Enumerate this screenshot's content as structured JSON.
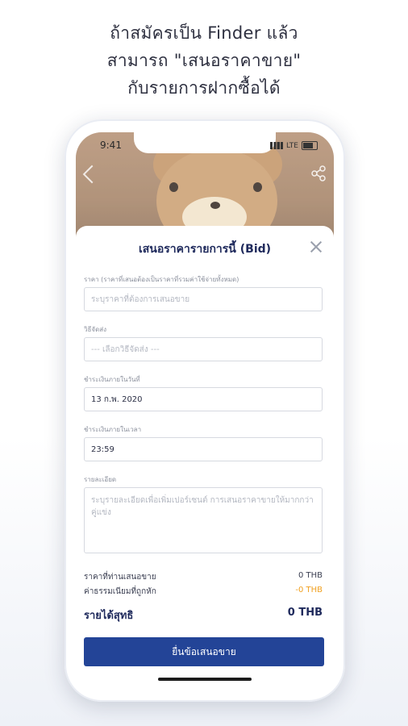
{
  "headline": {
    "line1": "ถ้าสมัครเป็น Finder แล้ว",
    "line2": "สามารถ \"เสนอราคาขาย\"",
    "line3": "กับรายการฝากซื้อได้"
  },
  "status_bar": {
    "time": "9:41",
    "network": "LTE"
  },
  "sheet": {
    "title": "เสนอราคารายการนี้ (Bid)",
    "price": {
      "label": "ราคา (ราคาที่เสนอต้องเป็นราคาที่รวมค่าใช้จ่ายทั้งหมด)",
      "placeholder": "ระบุราคาที่ต้องการเสนอขาย"
    },
    "shipping": {
      "label": "วิธีจัดส่ง",
      "placeholder": "--- เลือกวิธีจัดส่ง ---"
    },
    "date": {
      "label": "ชำระเงินภายในวันที่",
      "value": "13 ก.พ. 2020"
    },
    "time": {
      "label": "ชำระเงินภายในเวลา",
      "value": "23:59"
    },
    "details": {
      "label": "รายละเอียด",
      "placeholder": "ระบุรายละเอียดเพื่อเพิ่มเปอร์เซนต์ การเสนอราคาขายให้มากกว่าคู่แข่ง"
    },
    "summary": {
      "offer_label": "ราคาที่ท่านเสนอขาย",
      "offer_value": "0 THB",
      "fee_label": "ค่าธรรมเนียมที่ถูกหัก",
      "fee_value": "-0 THB",
      "net_label": "รายได้สุทธิ",
      "net_value": "0 THB"
    },
    "submit_label": "ยื่นข้อเสนอขาย"
  },
  "colors": {
    "primary": "#234497",
    "title": "#1f2a5c",
    "fee": "#f0a020"
  },
  "icons": [
    "back-arrow-icon",
    "share-icon",
    "close-icon"
  ]
}
